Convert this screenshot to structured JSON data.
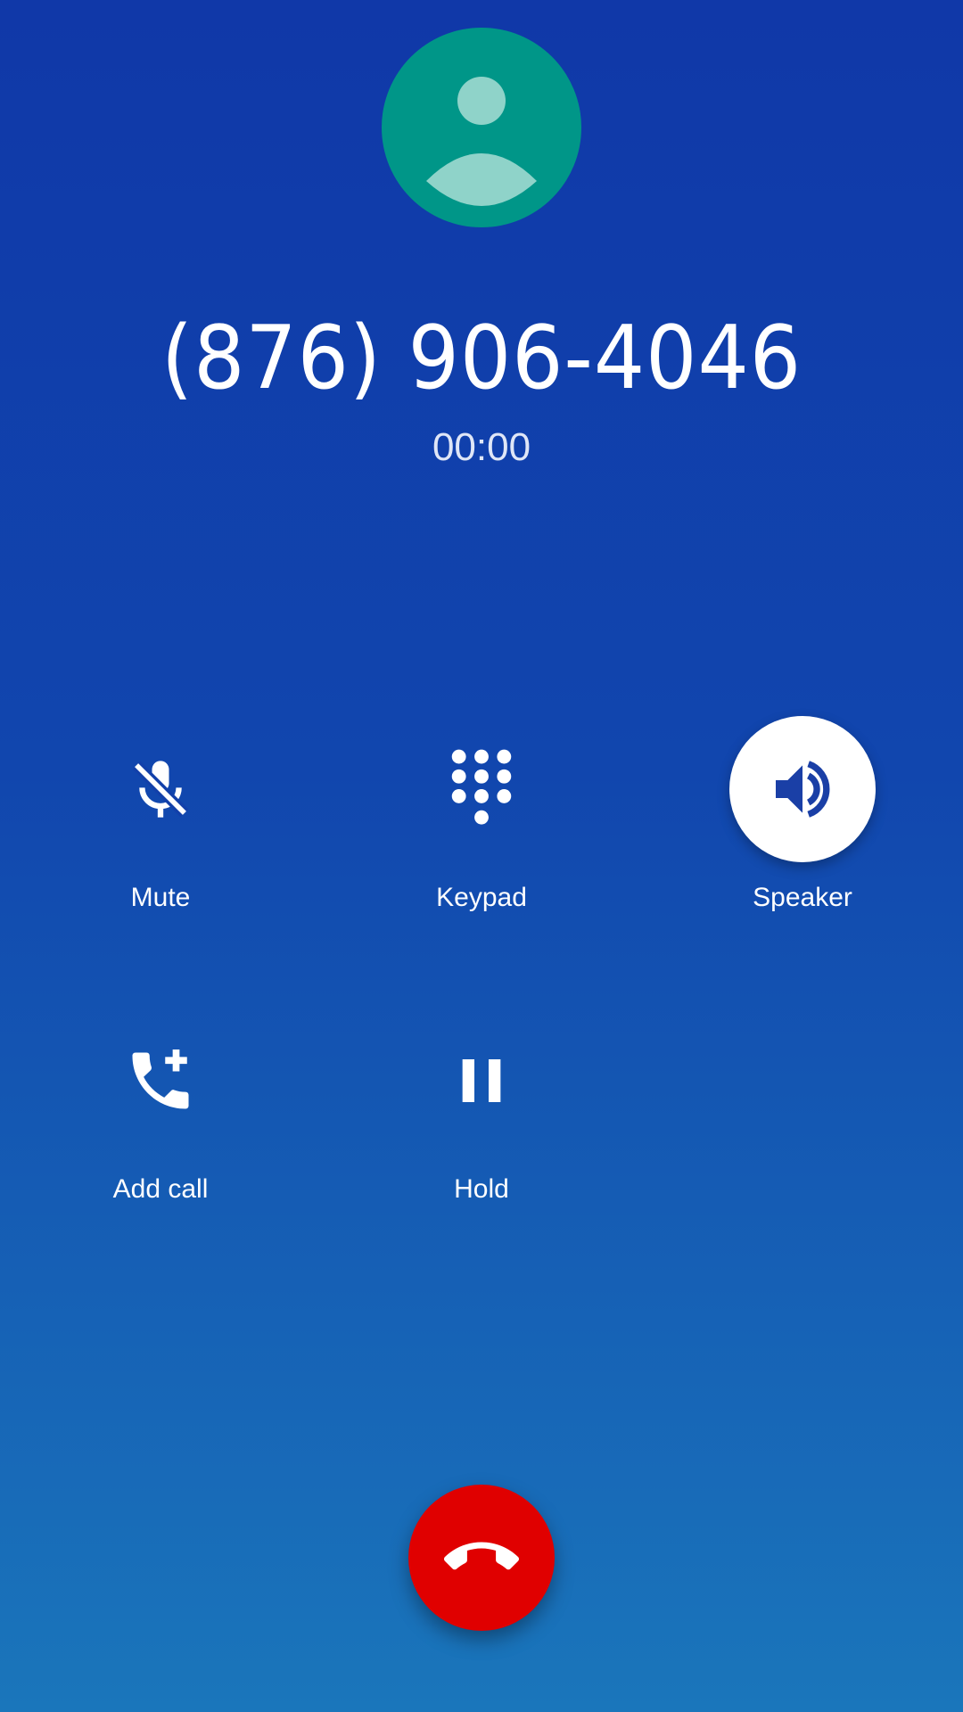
{
  "call": {
    "number": "(876) 906-4046",
    "timer": "00:00"
  },
  "controls": {
    "mute": {
      "label": "Mute",
      "icon": "mic-off-icon",
      "active": false
    },
    "keypad": {
      "label": "Keypad",
      "icon": "dialpad-icon",
      "active": false
    },
    "speaker": {
      "label": "Speaker",
      "icon": "volume-up-icon",
      "active": true
    },
    "add_call": {
      "label": "Add call",
      "icon": "add-call-icon",
      "active": false
    },
    "hold": {
      "label": "Hold",
      "icon": "pause-icon",
      "active": false
    }
  },
  "end_call": {
    "icon": "call-end-icon"
  },
  "colors": {
    "background_top": "#1038a8",
    "background_bottom": "#1a76bb",
    "avatar": "#009688",
    "end_call": "#e00000",
    "active_button": "#ffffff"
  }
}
